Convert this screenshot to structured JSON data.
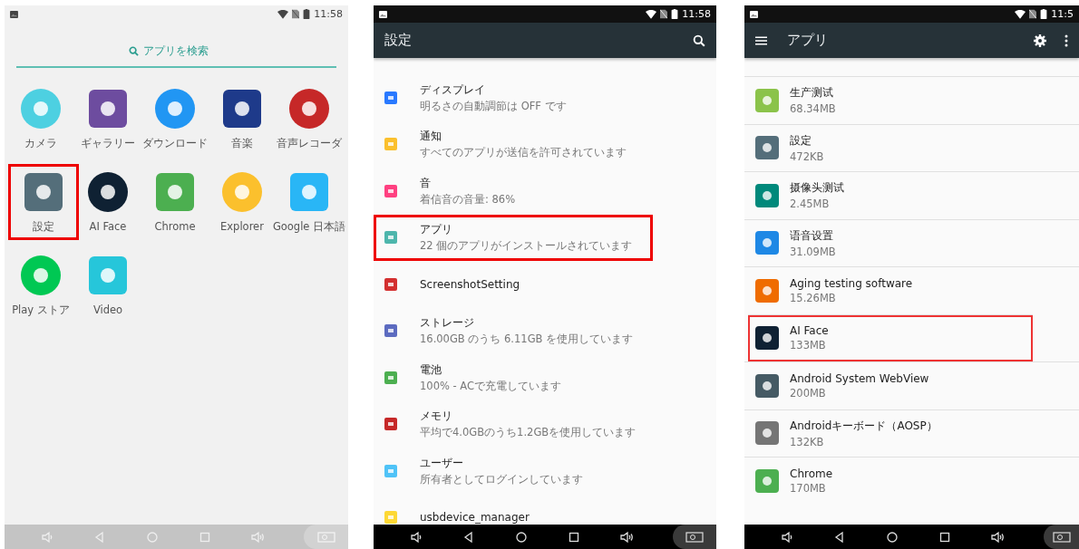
{
  "panels": [
    {
      "kind": "launcher",
      "status_bar": {
        "time": "11:58"
      },
      "search": {
        "placeholder": "アプリを検索"
      },
      "apps": [
        {
          "label": "カメラ",
          "color": "#4dd0e1",
          "highlighted": false
        },
        {
          "label": "ギャラリー",
          "color": "#6d4c9f",
          "highlighted": false
        },
        {
          "label": "ダウンロード",
          "color": "#2196f3",
          "highlighted": false
        },
        {
          "label": "音楽",
          "color": "#1e3a8a",
          "highlighted": false
        },
        {
          "label": "音声レコーダ",
          "color": "#c62828",
          "highlighted": false
        },
        {
          "label": "設定",
          "color": "#546e7a",
          "highlighted": true
        },
        {
          "label": "AI Face",
          "color": "#0f2133",
          "highlighted": false
        },
        {
          "label": "Chrome",
          "color": "#4caf50",
          "highlighted": false
        },
        {
          "label": "Explorer",
          "color": "#fbc02d",
          "highlighted": false
        },
        {
          "label": "Google 日本語",
          "color": "#29b6f6",
          "highlighted": false
        },
        {
          "label": "Play ストア",
          "color": "#00c853",
          "highlighted": false
        },
        {
          "label": "Video",
          "color": "#26c6da",
          "highlighted": false
        }
      ]
    },
    {
      "kind": "settings",
      "status_bar": {
        "time": "11:58"
      },
      "toolbar": {
        "title": "設定"
      },
      "items": [
        {
          "title": "ディスプレイ",
          "subtitle": "明るさの自動調節は OFF です",
          "color": "#2979ff",
          "highlighted": false
        },
        {
          "title": "通知",
          "subtitle": "すべてのアプリが送信を許可されています",
          "color": "#fbc02d",
          "highlighted": false
        },
        {
          "title": "音",
          "subtitle": "着信音の音量: 86%",
          "color": "#ff4081",
          "highlighted": false
        },
        {
          "title": "アプリ",
          "subtitle": "22 個のアプリがインストールされています",
          "color": "#4db6ac",
          "highlighted": true
        },
        {
          "title": "ScreenshotSetting",
          "color": "#d32f2f",
          "highlighted": false
        },
        {
          "title": "ストレージ",
          "subtitle": "16.00GB のうち 6.11GB を使用しています",
          "color": "#5c6bc0",
          "highlighted": false
        },
        {
          "title": "電池",
          "subtitle": "100% - ACで充電しています",
          "color": "#4caf50",
          "highlighted": false
        },
        {
          "title": "メモリ",
          "subtitle": "平均で4.0GBのうち1.2GBを使用しています",
          "color": "#c62828",
          "highlighted": false
        },
        {
          "title": "ユーザー",
          "subtitle": "所有者としてログインしています",
          "color": "#4fc3f7",
          "highlighted": false
        },
        {
          "title": "usbdevice_manager",
          "color": "#fdd835",
          "highlighted": false
        }
      ]
    },
    {
      "kind": "app_list",
      "status_bar": {
        "time": "11:5"
      },
      "toolbar": {
        "title": "アプリ"
      },
      "items": [
        {
          "name": "生产测试",
          "size": "68.34MB",
          "color": "#8bc34a",
          "highlighted": false
        },
        {
          "name": "設定",
          "size": "472KB",
          "color": "#546e7a",
          "highlighted": false
        },
        {
          "name": "摄像头测试",
          "size": "2.45MB",
          "color": "#00897b",
          "highlighted": false
        },
        {
          "name": "语音设置",
          "size": "31.09MB",
          "color": "#1e88e5",
          "highlighted": false
        },
        {
          "name": "Aging testing software",
          "size": "15.26MB",
          "color": "#ef6c00",
          "highlighted": false
        },
        {
          "name": "AI Face",
          "size": "133MB",
          "color": "#0f2133",
          "highlighted": true
        },
        {
          "name": "Android System WebView",
          "size": "200MB",
          "color": "#455a64",
          "highlighted": false
        },
        {
          "name": "Androidキーボード（AOSP）",
          "size": "132KB",
          "color": "#757575",
          "highlighted": false
        },
        {
          "name": "Chrome",
          "size": "170MB",
          "color": "#4caf50",
          "highlighted": false
        }
      ]
    }
  ]
}
